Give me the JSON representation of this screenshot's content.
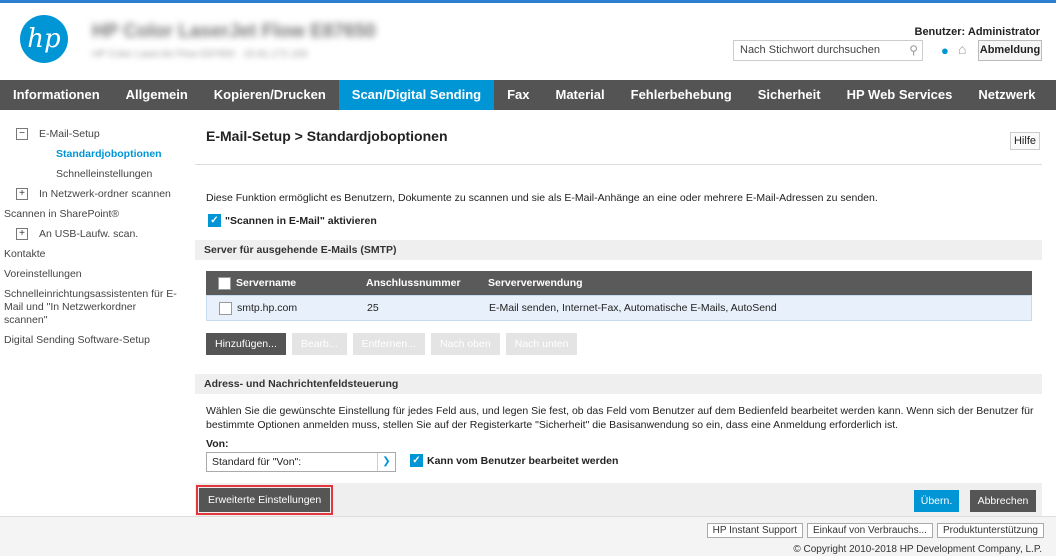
{
  "header": {
    "logo_text": "hp",
    "device_name": "HP Color LaserJet Flow E87650",
    "device_sub": "HP Color LaserJet Flow E87650 · 15.81.172.100",
    "search_placeholder": "Nach Stichwort durchsuchen",
    "user_label": "Benutzer: Administrator",
    "logout_label": "Abmeldung"
  },
  "nav": {
    "items": [
      "Informationen",
      "Allgemein",
      "Kopieren/Drucken",
      "Scan/Digital Sending",
      "Fax",
      "Material",
      "Fehlerbehebung",
      "Sicherheit",
      "HP Web Services",
      "Netzwerk"
    ],
    "active": "Scan/Digital Sending"
  },
  "sidebar": {
    "email_setup": "E-Mail-Setup",
    "default_job_options": "Standardjoboptionen",
    "quick_settings": "Schnelleinstellungen",
    "network_folder": "In Netzwerk-ordner scannen",
    "sharepoint": "Scannen in SharePoint®",
    "usb": "An USB-Laufw. scan.",
    "contacts": "Kontakte",
    "preferences": "Voreinstellungen",
    "wizard": "Schnelleinrichtungsassistenten für E-Mail und \"In Netzwerkordner scannen\"",
    "dss": "Digital Sending Software-Setup"
  },
  "main": {
    "title": "E-Mail-Setup > Standardjoboptionen",
    "help_label": "Hilfe",
    "description": "Diese Funktion ermöglicht es Benutzern, Dokumente zu scannen und sie als E-Mail-Anhänge an eine oder mehrere E-Mail-Adressen zu senden.",
    "enable_label": "\"Scannen in E-Mail\" aktivieren",
    "smtp_section": "Server für ausgehende E-Mails (SMTP)",
    "table": {
      "headers": [
        "Servername",
        "Anschlussnummer",
        "Serververwendung"
      ],
      "rows": [
        {
          "name": "smtp.hp.com",
          "port": "25",
          "usage": "E-Mail senden, Internet-Fax, Automatische E-Mails, AutoSend"
        }
      ]
    },
    "buttons": {
      "add": "Hinzufügen...",
      "edit": "Bearb...",
      "remove": "Entfernen...",
      "up": "Nach oben",
      "down": "Nach unten"
    },
    "address_section": "Adress- und Nachrichtenfeldsteuerung",
    "address_desc": "Wählen Sie die gewünschte Einstellung für jedes Feld aus, und legen Sie fest, ob das Feld vom Benutzer auf dem Bedienfeld bearbeitet werden kann. Wenn sich der Benutzer für bestimmte Optionen anmelden muss, stellen Sie auf der Registerkarte \"Sicherheit\" die Basisanwendung so ein, dass eine Anmeldung erforderlich ist.",
    "von_label": "Von:",
    "von_value": "Standard für \"Von\":",
    "editable_label": "Kann vom Benutzer bearbeitet werden",
    "advanced_label": "Erweiterte Einstellungen",
    "apply_label": "Übern.",
    "cancel_label": "Abbrechen"
  },
  "footer": {
    "links": [
      "HP Instant Support",
      "Einkauf von Verbrauchs...",
      "Produktunterstützung"
    ],
    "copyright": "© Copyright 2010-2018 HP Development Company, L.P."
  },
  "colors": {
    "accent": "#0096d6",
    "nav_bg": "#545454",
    "highlight": "#e2373d"
  }
}
